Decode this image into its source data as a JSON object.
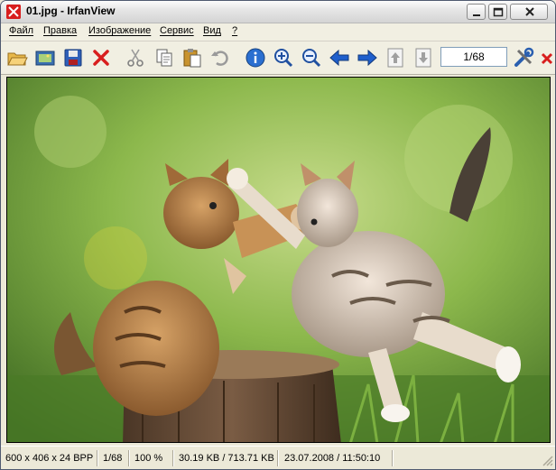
{
  "window": {
    "title": "01.jpg - IrfanView",
    "icon": "irfanview-app-icon"
  },
  "menu": {
    "items": [
      "Файл",
      "Правка",
      "Изображение",
      "Сервис",
      "Вид",
      "?"
    ]
  },
  "toolbar": {
    "page_counter": "1/68",
    "buttons": [
      "open-folder-icon",
      "slideshow-icon",
      "save-icon",
      "delete-icon",
      "cut-icon",
      "copy-icon",
      "paste-icon",
      "undo-icon",
      "info-icon",
      "zoom-in-icon",
      "zoom-out-icon",
      "previous-icon",
      "next-icon",
      "first-page-icon",
      "last-page-icon",
      "settings-icon",
      "exit-icon"
    ]
  },
  "image": {
    "description_icon": "photo-kittens"
  },
  "statusbar": {
    "dimensions": "600 x 406 x 24 BPP",
    "index": "1/68",
    "zoom": "100 %",
    "size": "30.19 KB / 713.71 KB",
    "datetime": "23.07.2008 / 11:50:10"
  },
  "colors": {
    "titlebar_top": "#fbfbfb",
    "close_red": "#d81e1e",
    "accent_blue": "#1f5fcc"
  }
}
